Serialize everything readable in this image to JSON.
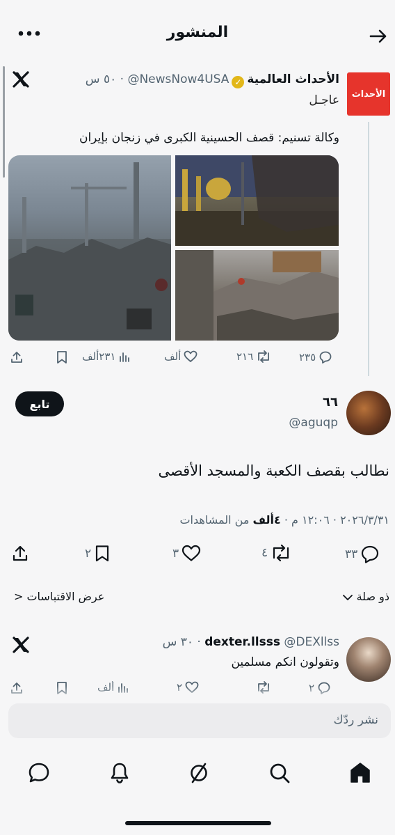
{
  "header": {
    "title": "المنشور"
  },
  "quoted_post": {
    "display_name": "الأحداث العالمية",
    "handle": "@NewsNow4USA",
    "time": "٥٠ س",
    "avatar_text": "الأحداث",
    "label": "عاجـل",
    "text": "وكالة تسنيم: قصف الحسينية الكبرى في زنجان بإيران",
    "stats": {
      "replies": "٢٣٥",
      "reposts": "٢١٦",
      "likes": "ألف",
      "views": "٢٣١ألف"
    }
  },
  "main_post": {
    "display_name": "٦٦",
    "handle": "@aguqp",
    "follow_label": "تابع",
    "text": "نطالب بقصف الكعبة والمسجد الأقصى",
    "meta_date": "٢٠٢٦/٣/٣١ · ١٢:٠٦ م · ",
    "meta_views": "٤ألف",
    "meta_views_suffix": " من المشاهدات",
    "stats": {
      "replies": "٣٣",
      "reposts": "٤",
      "likes": "٣",
      "bookmarks": "٢"
    }
  },
  "relevance": {
    "sort_label": "ذو صلة",
    "quotes_label": "عرض الاقتباسات <"
  },
  "reply": {
    "display_name": "dexter.llsss",
    "handle": "@DEXllss",
    "time": "٣٠ س",
    "text": "وتقولون انكم مسلمين",
    "stats": {
      "replies": "٢",
      "likes": "٢",
      "views": "ألف"
    }
  },
  "composer": {
    "placeholder": "نشر ردّك"
  },
  "nav": {
    "items": [
      "home-icon",
      "search-icon",
      "grok-icon",
      "notifications-icon",
      "messages-icon"
    ]
  }
}
